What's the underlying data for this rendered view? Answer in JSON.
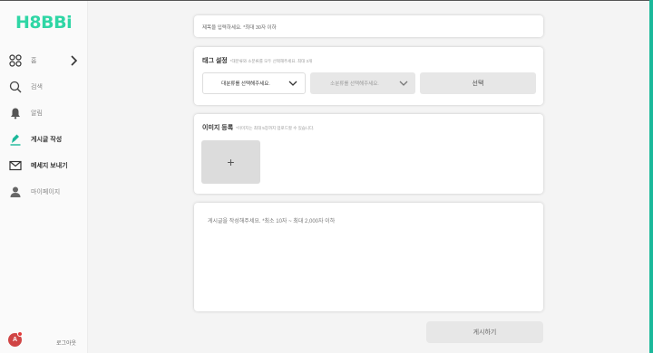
{
  "app": {
    "logo": "H8BBi"
  },
  "sidebar": {
    "items": [
      {
        "icon": "grid-icon",
        "label": "홈"
      },
      {
        "icon": "search-icon",
        "label": "검색"
      },
      {
        "icon": "bell-icon",
        "label": "알림"
      },
      {
        "icon": "pen-icon",
        "label": "게시글 작성"
      },
      {
        "icon": "mail-icon",
        "label": "메세지 보내기"
      },
      {
        "icon": "user-icon",
        "label": "마이페이지"
      }
    ],
    "logout": {
      "avatar_letter": "A",
      "label": "로그아웃"
    }
  },
  "form": {
    "title_placeholder": "제목을 입력하세요. *최대 30자 이하",
    "tag": {
      "title": "태그 설정",
      "hint": "*대분류와 소분류를 모두 선택해주세요. 최대 3개",
      "main_select_placeholder": "대분류를 선택해주세요.",
      "sub_select_placeholder": "소분류를 선택해주세요.",
      "select_button": "선택"
    },
    "image": {
      "title": "이미지 등록",
      "hint": "*이미지는 최대 5장까지 업로드할 수 있습니다.",
      "add_symbol": "+"
    },
    "content_placeholder": "게시글을 작성해주세요. *최소 10자 ~ 최대 2,000자 이하",
    "submit_label": "게시하기"
  },
  "colors": {
    "brand": "#2fd6a5",
    "accent_bar": "#1bb89a",
    "avatar": "#d04545"
  }
}
